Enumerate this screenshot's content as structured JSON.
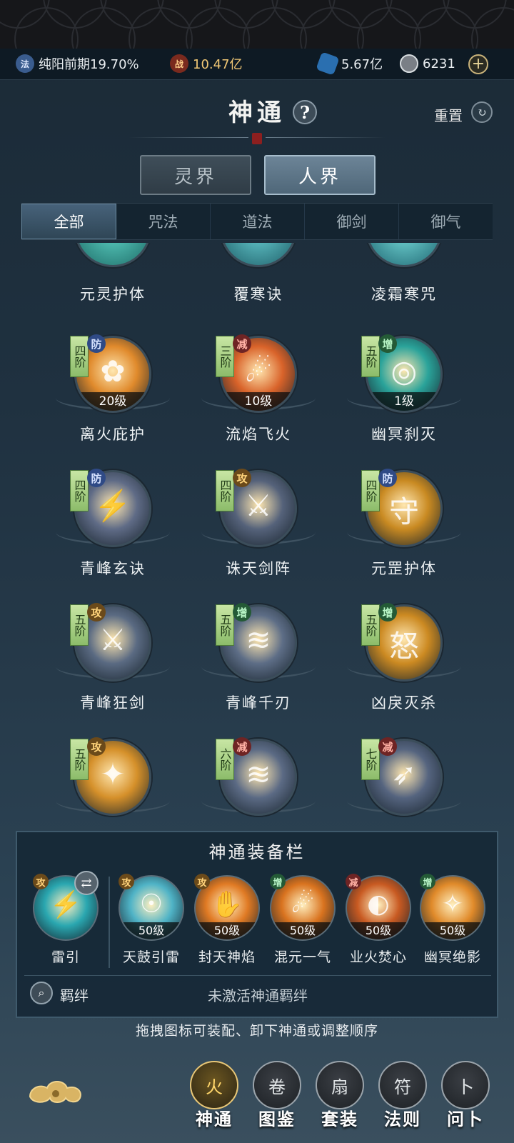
{
  "resources": {
    "cultivation_icon": "法",
    "cultivation": "纯阳前期19.70%",
    "power_icon": "战",
    "power": "10.47亿",
    "spirit_stone": "5.67亿",
    "currency": "6231",
    "plus_icon": "+"
  },
  "header": {
    "title": "神通",
    "help_icon": "?",
    "reset_label": "重置"
  },
  "realms": [
    {
      "label": "灵界",
      "active": false
    },
    {
      "label": "人界",
      "active": true
    }
  ],
  "tabs": [
    {
      "label": "全部",
      "active": true
    },
    {
      "label": "咒法"
    },
    {
      "label": "道法"
    },
    {
      "label": "御剑"
    },
    {
      "label": "御气"
    }
  ],
  "skills_partial": [
    {
      "name": "元灵护体",
      "color": "#2f8f86"
    },
    {
      "name": "覆寒诀",
      "color": "#2b7d84"
    },
    {
      "name": "凌霜寒咒",
      "color": "#2d8d92"
    }
  ],
  "skills": [
    {
      "name": "离火庇护",
      "tier": "四阶",
      "tag": "防",
      "tag_type": "def",
      "level": "20级",
      "color": "#e08a2c",
      "glyph": "✿"
    },
    {
      "name": "流焰飞火",
      "tier": "三阶",
      "tag": "减",
      "tag_type": "dmg",
      "level": "10级",
      "color": "#d9632a",
      "glyph": "☄"
    },
    {
      "name": "幽冥刹灭",
      "tier": "五阶",
      "tag": "增",
      "tag_type": "buf",
      "level": "1级",
      "color": "#2aa39a",
      "glyph": "◎"
    },
    {
      "name": "青峰玄诀",
      "tier": "四阶",
      "tag": "防",
      "tag_type": "def",
      "level": "",
      "color": "#5f6b86",
      "glyph": "⚡"
    },
    {
      "name": "诛天剑阵",
      "tier": "四阶",
      "tag": "攻",
      "tag_type": "atk",
      "level": "",
      "color": "#55627a",
      "glyph": "⚔"
    },
    {
      "name": "元罡护体",
      "tier": "四阶",
      "tag": "防",
      "tag_type": "def",
      "level": "",
      "color": "#c98a22",
      "glyph": "守"
    },
    {
      "name": "青峰狂剑",
      "tier": "五阶",
      "tag": "攻",
      "tag_type": "atk",
      "level": "",
      "color": "#5a6a82",
      "glyph": "⚔"
    },
    {
      "name": "青峰千刃",
      "tier": "五阶",
      "tag": "增",
      "tag_type": "buf",
      "level": "",
      "color": "#5d6d86",
      "glyph": "≋"
    },
    {
      "name": "凶戾灭杀",
      "tier": "五阶",
      "tag": "增",
      "tag_type": "buf",
      "level": "",
      "color": "#cc8a22",
      "glyph": "怒"
    },
    {
      "name": "",
      "tier": "五阶",
      "tag": "攻",
      "tag_type": "atk",
      "level": "",
      "color": "#d5902a",
      "glyph": "✦"
    },
    {
      "name": "",
      "tier": "六阶",
      "tag": "减",
      "tag_type": "dmg",
      "level": "",
      "color": "#5b6a84",
      "glyph": "≋"
    },
    {
      "name": "",
      "tier": "七阶",
      "tag": "减",
      "tag_type": "dmg",
      "level": "",
      "color": "#55647f",
      "glyph": "➶"
    }
  ],
  "equip": {
    "title": "神通装备栏",
    "slots": [
      {
        "name": "雷引",
        "tag": "攻",
        "tag_type": "atk",
        "level": "",
        "color": "#2aa7b0",
        "glyph": "⚡"
      },
      {
        "name": "天鼓引雷",
        "tag": "攻",
        "tag_type": "atk",
        "level": "50级",
        "color": "#4fb3c6",
        "glyph": "☉"
      },
      {
        "name": "封天神焰",
        "tag": "攻",
        "tag_type": "atk",
        "level": "50级",
        "color": "#e07a24",
        "glyph": "✋"
      },
      {
        "name": "混元一气",
        "tag": "增",
        "tag_type": "buf",
        "level": "50级",
        "color": "#d9731f",
        "glyph": "☄"
      },
      {
        "name": "业火焚心",
        "tag": "减",
        "tag_type": "dmg",
        "level": "50级",
        "color": "#c85a22",
        "glyph": "◐"
      },
      {
        "name": "幽冥绝影",
        "tag": "增",
        "tag_type": "buf",
        "level": "50级",
        "color": "#e08a2a",
        "glyph": "✧"
      }
    ],
    "swap_icon": "⇄",
    "bond_label": "羁绊",
    "bond_status": "未激活神通羁绊"
  },
  "hint": "拖拽图标可装配、卸下神通或调整顺序",
  "bottom_nav": [
    {
      "label": "神通",
      "active": true,
      "icon": "火"
    },
    {
      "label": "图鉴",
      "icon": "卷"
    },
    {
      "label": "套装",
      "icon": "扇"
    },
    {
      "label": "法则",
      "icon": "符"
    },
    {
      "label": "问卜",
      "icon": "卜"
    }
  ]
}
